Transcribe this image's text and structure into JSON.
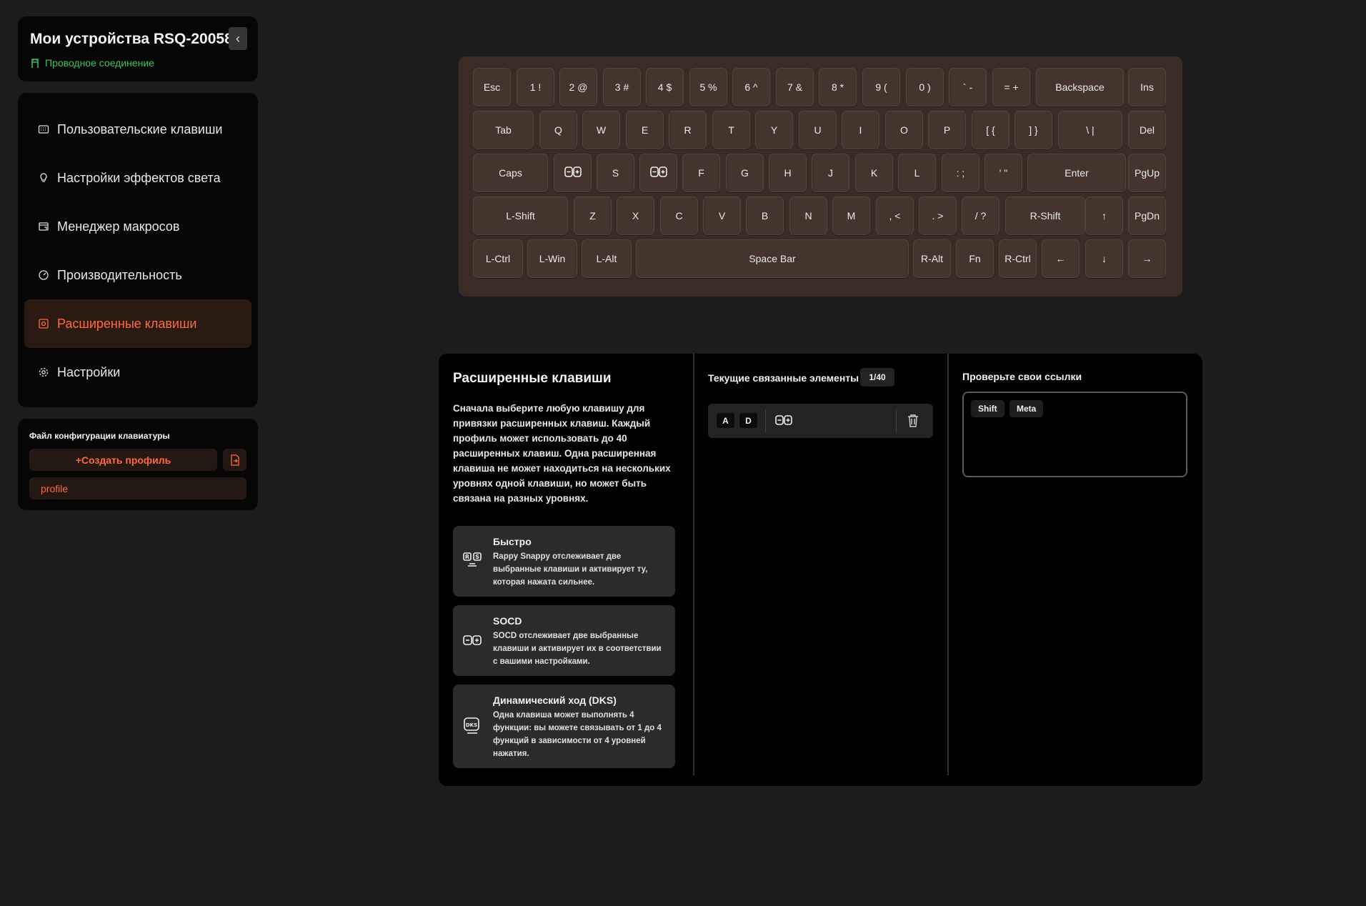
{
  "device": {
    "title": "Мои устройства RSQ-20058",
    "connection": "Проводное соединение",
    "collapse_glyph": "‹"
  },
  "nav": {
    "items": [
      {
        "label": "Пользовательские клавиши",
        "icon": "keyboard-icon",
        "active": false
      },
      {
        "label": "Настройки эффектов света",
        "icon": "bulb-icon",
        "active": false
      },
      {
        "label": "Менеджер макросов",
        "icon": "macro-icon",
        "active": false
      },
      {
        "label": "Производительность",
        "icon": "gauge-icon",
        "active": false
      },
      {
        "label": "Расширенные клавиши",
        "icon": "advanced-key-icon",
        "active": true
      },
      {
        "label": "Настройки",
        "icon": "gear-icon",
        "active": false
      }
    ]
  },
  "profile": {
    "title": "Файл конфигурации клавиатуры",
    "create_label": "+Создать профиль",
    "items": [
      "profile"
    ]
  },
  "keyboard": {
    "rows": [
      [
        "Esc",
        "1 !",
        "2 @",
        "3 #",
        "4 $",
        "5 %",
        "6 ^",
        "7 &",
        "8 *",
        "9 (",
        "0 )",
        "` -",
        "= +",
        "Backspace",
        "Ins"
      ],
      [
        "Tab",
        "Q",
        "W",
        "E",
        "R",
        "T",
        "Y",
        "U",
        "I",
        "O",
        "P",
        "[ {",
        "] }",
        "\\ |",
        "Del"
      ],
      [
        "Caps",
        "",
        "S",
        "",
        "F",
        "G",
        "H",
        "J",
        "K",
        "L",
        ": ;",
        "' \"",
        "Enter",
        "PgUp"
      ],
      [
        "L-Shift",
        "Z",
        "X",
        "C",
        "V",
        "B",
        "N",
        "M",
        ", <",
        ". >",
        "/ ?",
        "R-Shift",
        "↑",
        "PgDn"
      ],
      [
        "L-Ctrl",
        "L-Win",
        "L-Alt",
        "Space Bar",
        "R-Alt",
        "Fn",
        "R-Ctrl",
        "←",
        "↓",
        "→"
      ]
    ]
  },
  "advanced": {
    "title": "Расширенные клавиши",
    "description": "Сначала выберите любую клавишу для привязки расширенных клавиш. Каждый профиль может использовать до 40 расширенных клавиш. Одна расширенная клавиша не может находиться на нескольких уровнях одной клавиши, но может быть связана на разных уровнях.",
    "features": [
      {
        "title": "Быстро",
        "description": "Rappy Snappy отслеживает две выбранные клавиши и активирует ту, которая нажата сильнее.",
        "icon": "rappy-snappy-icon"
      },
      {
        "title": "SOCD",
        "description": "SOCD отслеживает две выбранные клавиши и активирует их в соответствии с вашими настройками.",
        "icon": "socd-icon"
      },
      {
        "title": "Динамический ход (DKS)",
        "description": "Одна клавиша может выполнять 4 функции: вы можете связывать от 1 до 4 функций в зависимости от 4 уровней нажатия.",
        "icon": "dks-icon"
      }
    ]
  },
  "current": {
    "title": "Текущие связанные элементы",
    "count": "1/40",
    "linked": [
      {
        "keys": [
          "A",
          "D"
        ],
        "type_icon": "socd-icon"
      }
    ]
  },
  "check": {
    "title": "Проверьте свои ссылки",
    "modifiers": [
      "Shift",
      "Meta"
    ]
  },
  "colors": {
    "accent": "#ff6a3d",
    "connection": "#3fc15c",
    "key": "#44342c",
    "keyboard_bg": "#3a2b24"
  }
}
